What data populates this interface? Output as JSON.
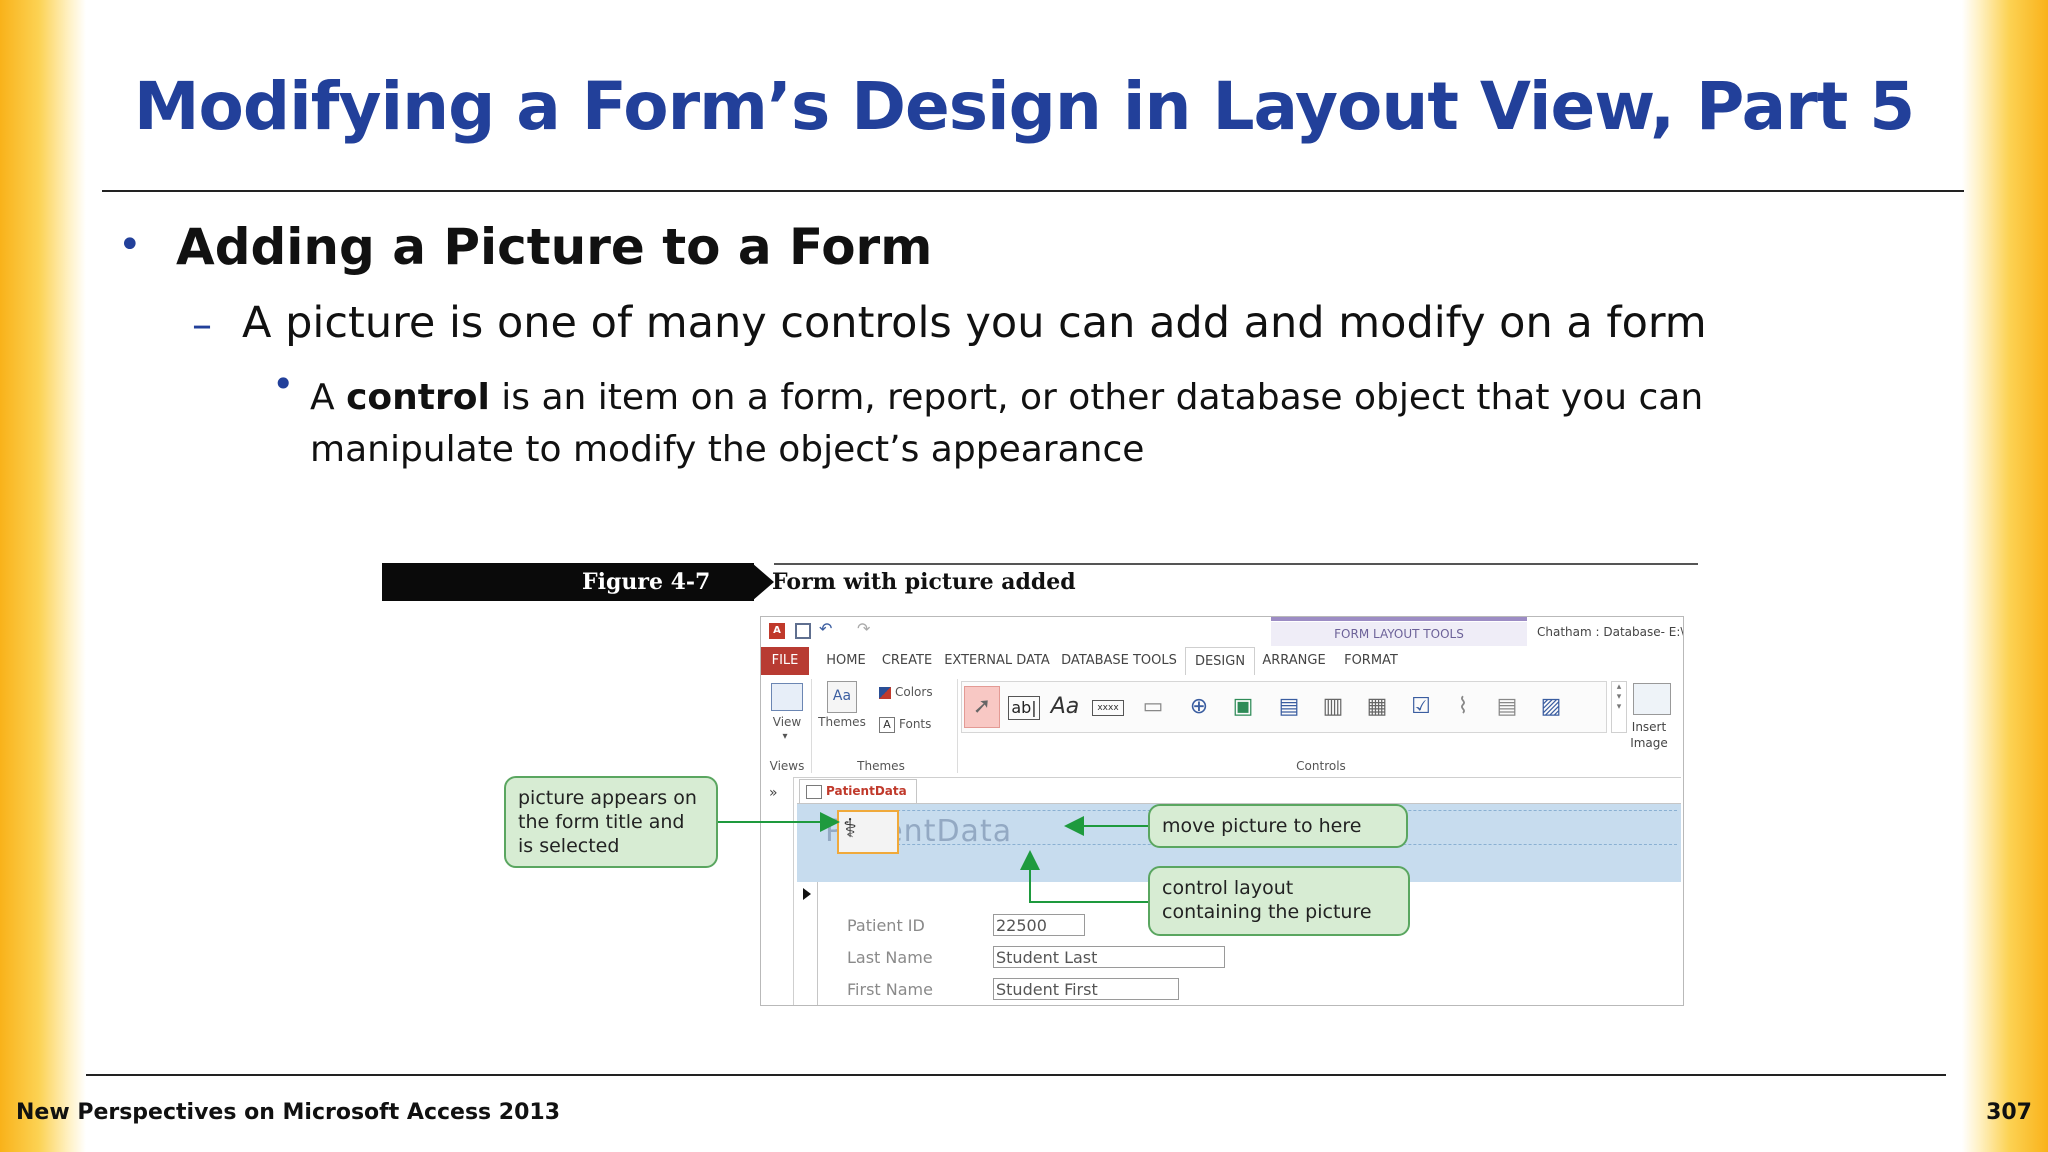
{
  "slide": {
    "title": "Modifying a Form’s Design in Layout View, Part 5",
    "bullet1": "Adding a Picture to a Form",
    "bullet2": "A picture is one of many controls you can add and modify on a form",
    "bullet3_pre": "A ",
    "bullet3_keyword": "control",
    "bullet3_post": " is an item on a form, report, or other database object that you can manipulate to modify the object’s appearance",
    "footer_left": "New Perspectives on Microsoft Access 2013",
    "page_number": "307",
    "bullet_glyph": "•",
    "dash_glyph": "–"
  },
  "figure": {
    "number": "Figure 4-7",
    "caption": "Form with picture added",
    "access": {
      "contextual_tools": "FORM LAYOUT TOOLS",
      "window_title": "Chatham : Database- E:\\",
      "tabs": [
        "FILE",
        "HOME",
        "CREATE",
        "EXTERNAL DATA",
        "DATABASE TOOLS",
        "DESIGN",
        "ARRANGE",
        "FORMAT"
      ],
      "ribbon": {
        "view_label": "View",
        "views_group": "Views",
        "themes_label": "Themes",
        "colors_label": "Colors",
        "fonts_label": "Fonts",
        "themes_group": "Themes",
        "controls_group": "Controls",
        "insert_image_label_1": "Insert",
        "insert_image_label_2": "Image"
      },
      "document_tab": "PatientData",
      "header_title": "PatientData",
      "fields": [
        {
          "label": "Patient ID",
          "value": "22500"
        },
        {
          "label": "Last Name",
          "value": "Student Last"
        },
        {
          "label": "First Name",
          "value": "Student First"
        }
      ]
    },
    "callouts": {
      "picture": "picture appears on the form title and is selected",
      "move": "move picture to here",
      "layout": "control layout containing the picture"
    },
    "colors": {
      "title_blue": "#22409a",
      "callout_fill": "#d7ecd3",
      "callout_border": "#5aa660",
      "arrow_green": "#1e9a3e",
      "file_tab": "#b83b32",
      "form_header": "#c7dcee"
    }
  }
}
